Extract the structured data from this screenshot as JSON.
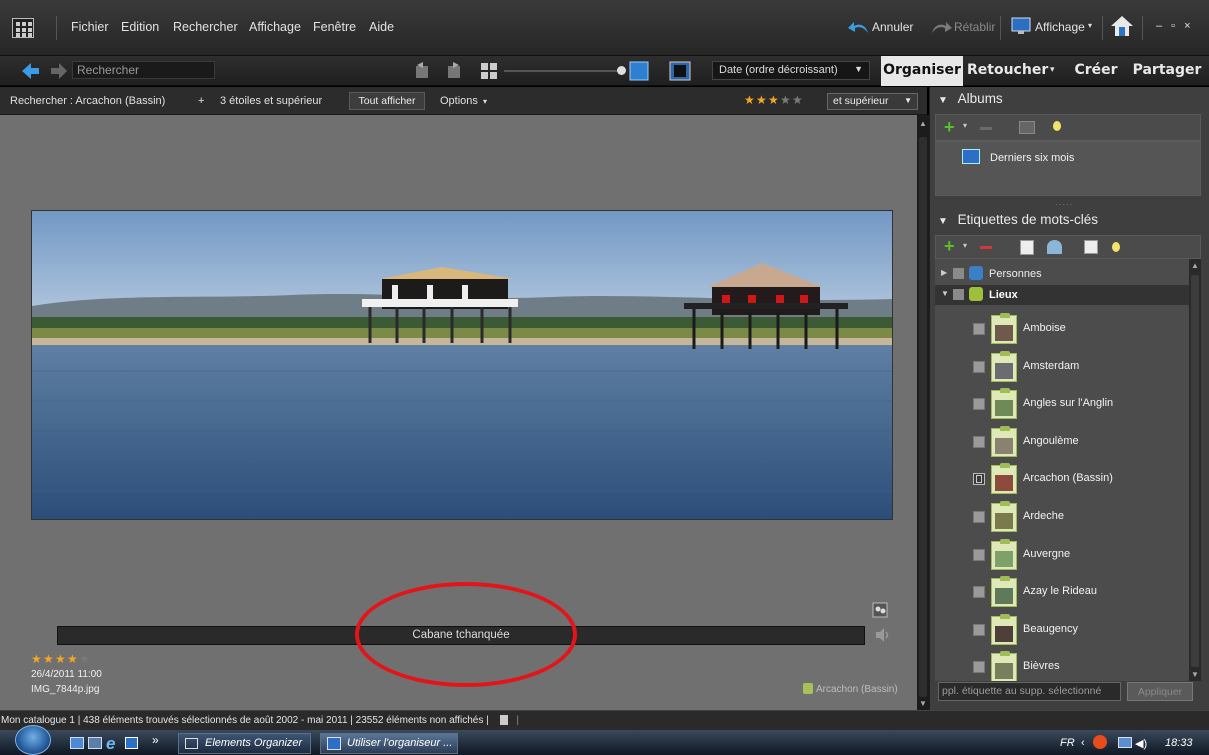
{
  "menubar": {
    "items": [
      "Fichier",
      "Edition",
      "Rechercher",
      "Affichage",
      "Fenêtre",
      "Aide"
    ],
    "undo_label": "Annuler",
    "redo_label": "Rétablir",
    "display_label": "Affichage",
    "window_controls": "– ▫ ×"
  },
  "toolbar": {
    "search_value": "Rechercher",
    "sort_value": "Date (ordre décroissant)",
    "tabs": [
      "Organiser",
      "Retoucher",
      "Créer",
      "Partager"
    ]
  },
  "filterbar": {
    "search_label": "Rechercher : Arcachon (Bassin)",
    "plus": "+",
    "criteria": "3 étoiles et supérieur",
    "show_all_label": "Tout afficher",
    "options_label": "Options",
    "rating_select_value": "et supérieur",
    "rating": 3,
    "rating_max": 5
  },
  "viewer": {
    "caption": "Cabane tchanquée",
    "stars": 4,
    "stars_max": 5,
    "date": "26/4/2011 11:00",
    "filename": "IMG_7844p.jpg",
    "location_tag": "Arcachon (Bassin)"
  },
  "albums": {
    "title": "Albums",
    "items": [
      {
        "label": "Derniers six mois"
      }
    ]
  },
  "keywords": {
    "title": "Etiquettes de mots-clés",
    "categories": [
      "Personnes",
      "Lieux"
    ],
    "places": [
      {
        "label": "Amboise",
        "checked": false,
        "color": "#6d5a4a"
      },
      {
        "label": "Amsterdam",
        "checked": false,
        "color": "#6b6b72"
      },
      {
        "label": "Angles sur l'Anglin",
        "checked": false,
        "color": "#6f8a58"
      },
      {
        "label": "Angoulème",
        "checked": false,
        "color": "#8a8270"
      },
      {
        "label": "Arcachon (Bassin)",
        "checked": true,
        "color": "#8c4b3c"
      },
      {
        "label": "Ardeche",
        "checked": false,
        "color": "#7a7a4c"
      },
      {
        "label": "Auvergne",
        "checked": false,
        "color": "#7ea06a"
      },
      {
        "label": "Azay le Rideau",
        "checked": false,
        "color": "#5f7a58"
      },
      {
        "label": "Beaugency",
        "checked": false,
        "color": "#4e3f38"
      },
      {
        "label": "Bièvres",
        "checked": false,
        "color": "#77805a"
      }
    ],
    "apply_placeholder": "ppl. étiquette au supp. sélectionné",
    "apply_label": "Appliquer"
  },
  "statusbar": {
    "text": "Mon catalogue 1  |  438 éléments trouvés sélectionnés  de août 2002 - mai 2011  |  23552 éléments non affichés  |"
  },
  "taskbar": {
    "overflow": "»",
    "buttons": [
      "Elements Organizer",
      "Utiliser l'organiseur ..."
    ],
    "lang": "FR",
    "time": "18:33"
  },
  "colors": {
    "accent_star": "#f5a623",
    "highlight_ellipse": "#e4141b",
    "tag_frame": "#9fbc57"
  }
}
